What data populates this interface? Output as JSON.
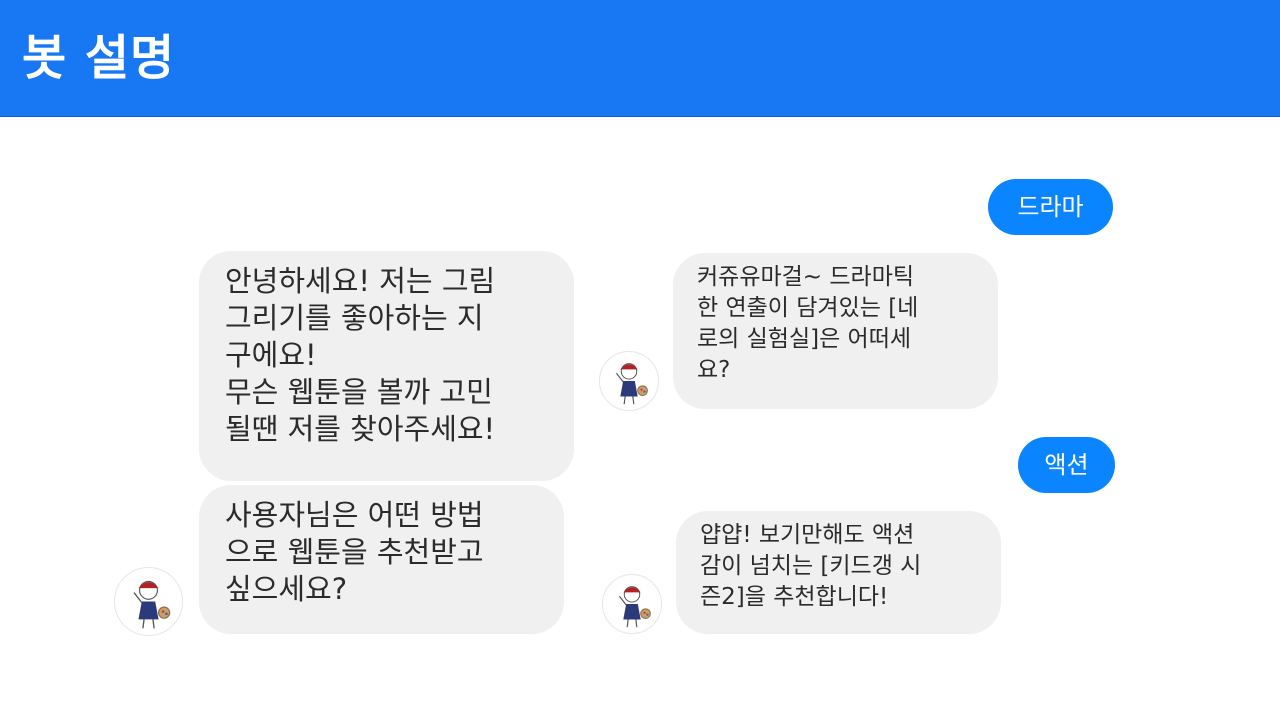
{
  "header": {
    "title": "봇 설명"
  },
  "left_chat": {
    "greeting": "안녕하세요! 저는 그림\n그리기를 좋아하는 지\n구에요!\n무슨 웹툰을 볼까 고민\n될땐 저를 찾아주세요!",
    "question": "사용자님은 어떤 방법\n으로 웹툰을 추천받고\n싶으세요?"
  },
  "right_chat": {
    "user_reply_1": "드라마",
    "bot_reply_1": "커쥬유마걸~ 드라마틱\n한 연출이 담겨있는 [네\n로의 실험실]은 어떠세\n요?",
    "user_reply_2": "액션",
    "bot_reply_2": "얍얍! 보기만해도 액션\n감이 넘치는 [키드갱 시\n즌2]을 추천합니다!"
  },
  "colors": {
    "header_bg": "#1877f2",
    "user_bubble": "#0a84ff",
    "bot_bubble": "#f0f0f0"
  }
}
